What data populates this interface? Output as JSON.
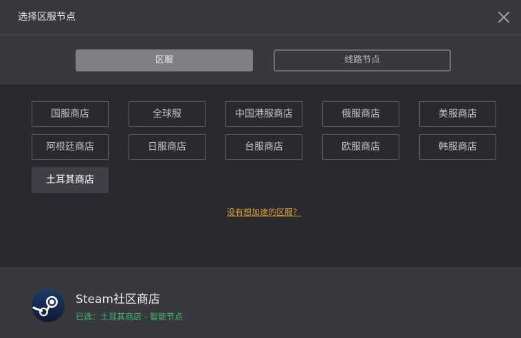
{
  "header": {
    "title": "选择区服节点"
  },
  "tabs": {
    "region": "区服",
    "route": "线路节点",
    "active": "region"
  },
  "regions": [
    "国服商店",
    "全球服",
    "中国港服商店",
    "俄服商店",
    "美服商店",
    "阿根廷商店",
    "日服商店",
    "台服商店",
    "欧服商店",
    "韩服商店",
    "土耳其商店"
  ],
  "selected_region": "土耳其商店",
  "missing_link": "没有想加速的区服？",
  "footer": {
    "game_title": "Steam社区商店",
    "status": "已选：土耳其商店 - 智能节点"
  },
  "colors": {
    "accent_link": "#d9a23a",
    "status_green": "#3fbe74",
    "active_tab": "#808084"
  },
  "icons": {
    "close": "close-icon",
    "steam": "steam-logo-icon"
  }
}
